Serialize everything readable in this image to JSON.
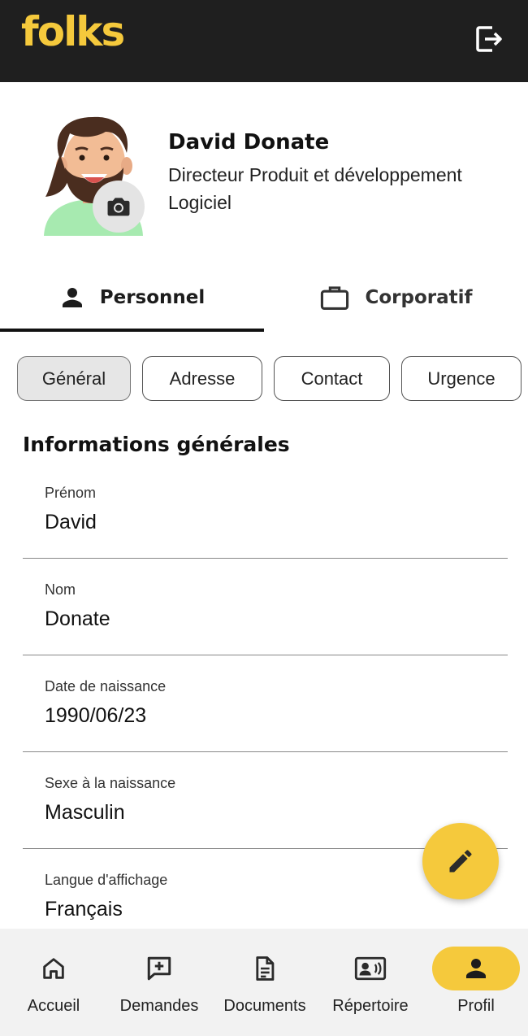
{
  "app": {
    "brand": "folks"
  },
  "profile": {
    "name": "David Donate",
    "role": "Directeur Produit et développement Logiciel"
  },
  "tabs": [
    {
      "label": "Personnel",
      "icon": "person-icon",
      "active": true
    },
    {
      "label": "Corporatif",
      "icon": "briefcase-icon",
      "active": false
    }
  ],
  "chips": [
    {
      "label": "Général",
      "active": true
    },
    {
      "label": "Adresse",
      "active": false
    },
    {
      "label": "Contact",
      "active": false
    },
    {
      "label": "Urgence",
      "active": false
    }
  ],
  "section": {
    "title": "Informations générales"
  },
  "fields": [
    {
      "label": "Prénom",
      "value": "David"
    },
    {
      "label": "Nom",
      "value": "Donate"
    },
    {
      "label": "Date de naissance",
      "value": "1990/06/23"
    },
    {
      "label": "Sexe à la naissance",
      "value": "Masculin"
    },
    {
      "label": "Langue d'affichage",
      "value": "Français"
    }
  ],
  "nav": [
    {
      "label": "Accueil",
      "icon": "home-icon",
      "active": false
    },
    {
      "label": "Demandes",
      "icon": "add-comment-icon",
      "active": false
    },
    {
      "label": "Documents",
      "icon": "document-icon",
      "active": false
    },
    {
      "label": "Répertoire",
      "icon": "contact-card-icon",
      "active": false
    },
    {
      "label": "Profil",
      "icon": "person-icon",
      "active": true
    }
  ],
  "colors": {
    "accent": "#f5c93c",
    "topbar": "#1f1f1f",
    "navbar": "#f2f2f2"
  }
}
